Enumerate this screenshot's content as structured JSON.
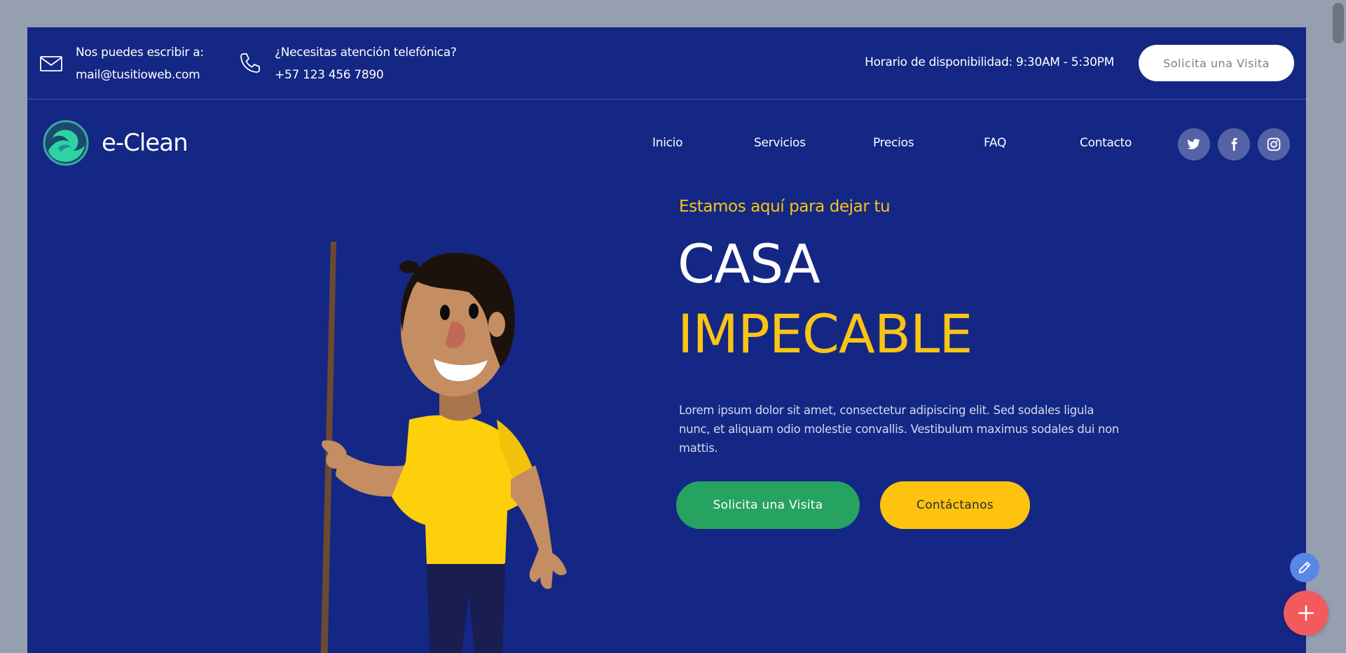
{
  "topbar": {
    "email": {
      "label": "Nos puedes escribir a:",
      "value": "mail@tusitioweb.com",
      "icon": "envelope-icon"
    },
    "phone": {
      "label": "¿Necesitas atención telefónica?",
      "value": "+57 123 456 7890",
      "icon": "phone-icon"
    },
    "hours": "Horario de disponibilidad: 9:30AM - 5:30PM",
    "cta": "Solicita una Visita"
  },
  "nav": {
    "brand": "e-Clean",
    "items": [
      "Inicio",
      "Servicios",
      "Precios",
      "FAQ",
      "Contacto"
    ],
    "social": [
      "twitter-icon",
      "facebook-icon",
      "instagram-icon"
    ]
  },
  "hero": {
    "kicker": "Estamos aquí para dejar tu",
    "title_line1": "CASA",
    "title_line2": "IMPECABLE",
    "description": "Lorem ipsum dolor sit amet, consectetur adipiscing elit. Sed sodales ligula nunc, et aliquam odio molestie convallis. Vestibulum maximus sodales dui non mattis.",
    "primary_button": "Solicita una Visita",
    "secondary_button": "Contáctanos"
  },
  "colors": {
    "background": "#142784",
    "accent_yellow": "#f9c413",
    "green": "#26a261",
    "fab_red": "#f25a5d",
    "fab_blue": "#5a86e8"
  }
}
